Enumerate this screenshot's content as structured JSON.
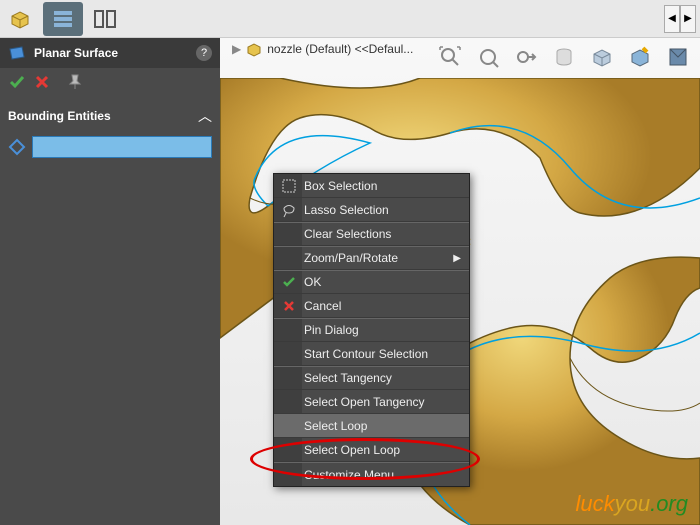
{
  "panel": {
    "title": "Planar Surface",
    "section_label": "Bounding Entities"
  },
  "breadcrumb": {
    "item": "nozzle (Default) <<Defaul..."
  },
  "context_menu": {
    "box_selection": "Box Selection",
    "lasso_selection": "Lasso Selection",
    "clear_selections": "Clear Selections",
    "zoom_pan_rotate": "Zoom/Pan/Rotate",
    "ok": "OK",
    "cancel": "Cancel",
    "pin_dialog": "Pin Dialog",
    "start_contour": "Start Contour Selection",
    "select_tangency": "Select Tangency",
    "select_open_tangency": "Select Open Tangency",
    "select_loop": "Select Loop",
    "select_open_loop": "Select Open Loop",
    "customize_menu": "Customize Menu"
  },
  "watermark": "luckyou.org"
}
